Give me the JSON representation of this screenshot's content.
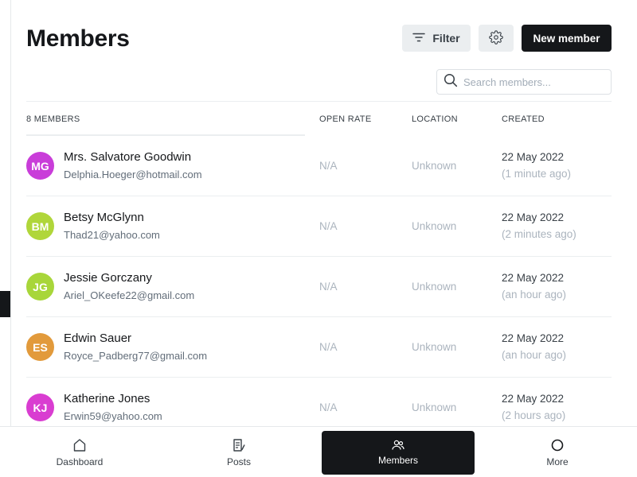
{
  "header": {
    "title": "Members",
    "filter_label": "Filter",
    "new_member_label": "New member",
    "search_placeholder": "Search members..."
  },
  "table": {
    "count_label": "8 MEMBERS",
    "columns": [
      "OPEN RATE",
      "LOCATION",
      "CREATED"
    ],
    "rows": [
      {
        "initials": "MG",
        "color": "#c93dd9",
        "name": "Mrs. Salvatore Goodwin",
        "email": "Delphia.Hoeger@hotmail.com",
        "open_rate": "N/A",
        "location": "Unknown",
        "created": "22 May 2022",
        "ago": "(1 minute ago)"
      },
      {
        "initials": "BM",
        "color": "#b0d63a",
        "name": "Betsy McGlynn",
        "email": "Thad21@yahoo.com",
        "open_rate": "N/A",
        "location": "Unknown",
        "created": "22 May 2022",
        "ago": "(2 minutes ago)"
      },
      {
        "initials": "JG",
        "color": "#a8d63a",
        "name": "Jessie Gorczany",
        "email": "Ariel_OKeefe22@gmail.com",
        "open_rate": "N/A",
        "location": "Unknown",
        "created": "22 May 2022",
        "ago": "(an hour ago)"
      },
      {
        "initials": "ES",
        "color": "#e29a3b",
        "name": "Edwin Sauer",
        "email": "Royce_Padberg77@gmail.com",
        "open_rate": "N/A",
        "location": "Unknown",
        "created": "22 May 2022",
        "ago": "(an hour ago)"
      },
      {
        "initials": "KJ",
        "color": "#d93dd1",
        "name": "Katherine Jones",
        "email": "Erwin59@yahoo.com",
        "open_rate": "N/A",
        "location": "Unknown",
        "created": "22 May 2022",
        "ago": "(2 hours ago)"
      }
    ]
  },
  "nav": {
    "items": [
      {
        "label": "Dashboard",
        "icon": "home-icon"
      },
      {
        "label": "Posts",
        "icon": "posts-icon"
      },
      {
        "label": "Members",
        "icon": "members-icon",
        "active": true
      },
      {
        "label": "More",
        "icon": "more-icon"
      }
    ]
  }
}
